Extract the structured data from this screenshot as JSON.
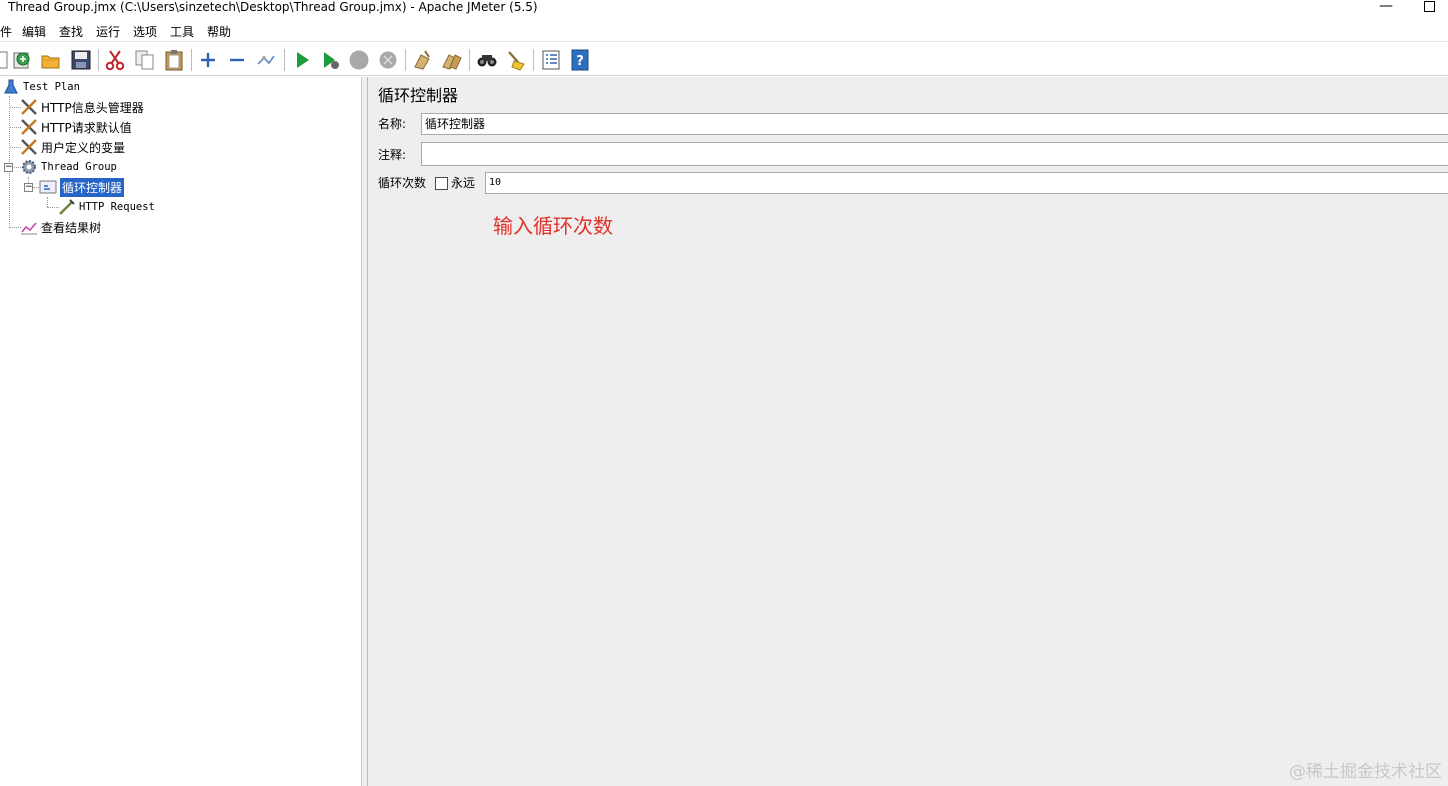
{
  "window": {
    "title": "Thread Group.jmx (C:\\Users\\sinzetech\\Desktop\\Thread Group.jmx) - Apache JMeter (5.5)",
    "minimize_glyph": "—"
  },
  "menu": {
    "items": [
      {
        "label": "件"
      },
      {
        "label": "编辑"
      },
      {
        "label": "查找"
      },
      {
        "label": "运行"
      },
      {
        "label": "选项"
      },
      {
        "label": "工具"
      },
      {
        "label": "帮助"
      }
    ]
  },
  "toolbar": {
    "icons": [
      {
        "name": "new-icon"
      },
      {
        "name": "templates-icon"
      },
      {
        "name": "open-icon"
      },
      {
        "name": "save-icon"
      },
      {
        "name": "cut-icon"
      },
      {
        "name": "copy-icon"
      },
      {
        "name": "paste-icon"
      },
      {
        "name": "expand-icon"
      },
      {
        "name": "collapse-icon"
      },
      {
        "name": "toggle-icon"
      },
      {
        "name": "start-icon"
      },
      {
        "name": "start-no-pauses-icon"
      },
      {
        "name": "stop-icon"
      },
      {
        "name": "shutdown-icon"
      },
      {
        "name": "clear-icon"
      },
      {
        "name": "clear-all-icon"
      },
      {
        "name": "search-icon"
      },
      {
        "name": "reset-search-icon"
      },
      {
        "name": "function-helper-icon"
      },
      {
        "name": "help-icon"
      }
    ]
  },
  "tree": {
    "nodes": [
      {
        "label": "Test Plan",
        "icon": "test-plan-icon"
      },
      {
        "label": "HTTP信息头管理器",
        "icon": "config-element-icon"
      },
      {
        "label": "HTTP请求默认值",
        "icon": "config-element-icon"
      },
      {
        "label": "用户定义的变量",
        "icon": "config-element-icon"
      },
      {
        "label": "Thread Group",
        "icon": "thread-group-icon"
      },
      {
        "label": "循环控制器",
        "icon": "loop-controller-icon",
        "selected": true
      },
      {
        "label": "HTTP Request",
        "icon": "sampler-icon"
      },
      {
        "label": "查看结果树",
        "icon": "listener-icon"
      }
    ]
  },
  "panel": {
    "title": "循环控制器",
    "name_label": "名称:",
    "name_value": "循环控制器",
    "comment_label": "注释:",
    "comment_value": "",
    "loop_label": "循环次数",
    "forever_label": "永远",
    "forever_checked": false,
    "loop_value": "10",
    "annotation": "输入循环次数"
  },
  "watermark": "@稀土掘金技术社区",
  "colors": {
    "selection": "#2764c8",
    "annotation": "#e0322a",
    "panel_bg": "#eeeeee"
  }
}
